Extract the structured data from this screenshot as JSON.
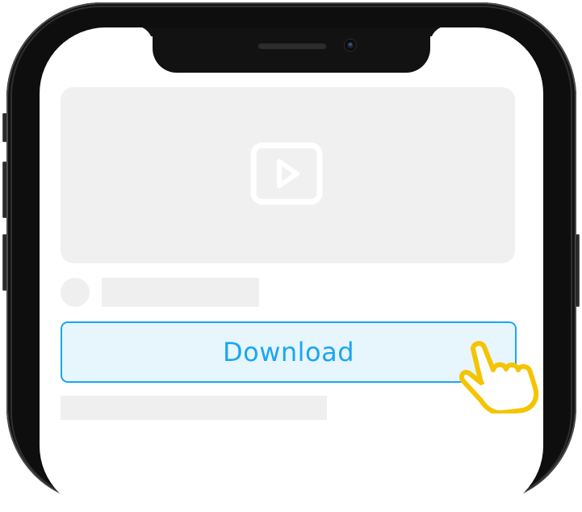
{
  "device": {
    "frame_color": "#1b1b1b",
    "screen_color": "#ffffff"
  },
  "video_card": {
    "icon": "play-icon",
    "placeholder_color": "#f0f0f0",
    "icon_color": "#ffffff"
  },
  "download_button": {
    "label": "Download",
    "text_color": "#1aa6f2",
    "border_color": "#1aa6f2",
    "background_color": "#e7f5fd"
  },
  "cursor": {
    "icon": "pointing-hand-icon",
    "fill_color": "#ffffff",
    "outline_color": "#f5c400"
  }
}
